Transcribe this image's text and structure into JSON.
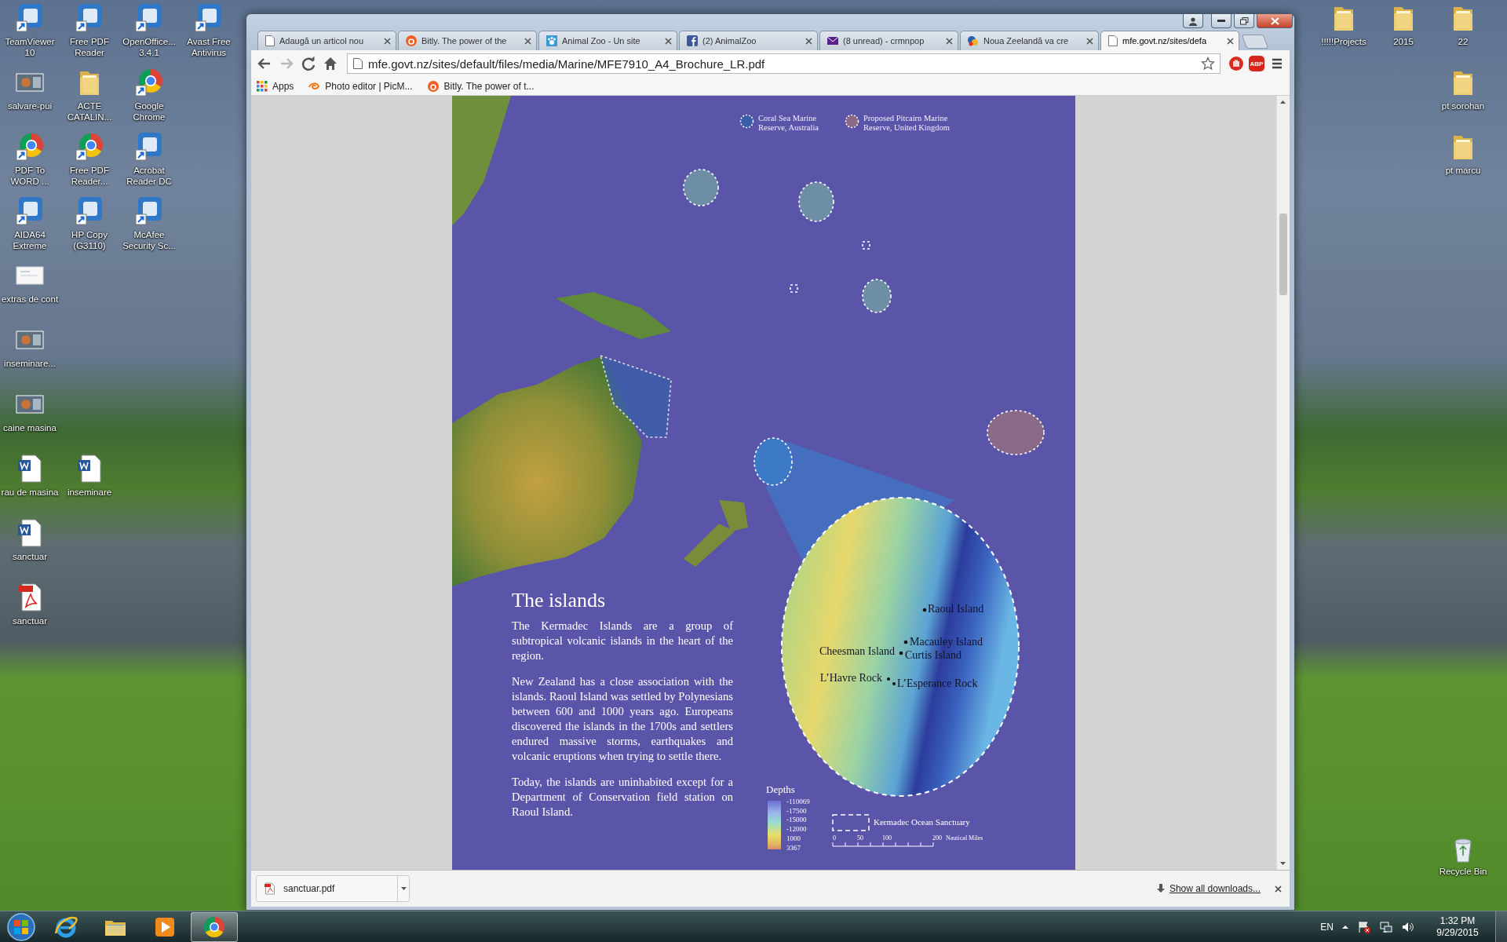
{
  "desktop": {
    "left_icons": [
      [
        {
          "label": "TeamViewer 10",
          "kind": "app",
          "shortcut": true
        },
        {
          "label": "Free PDF Reader",
          "kind": "app",
          "shortcut": true
        },
        {
          "label": "OpenOffice... 3.4.1",
          "kind": "app",
          "shortcut": true
        },
        {
          "label": "Avast Free Antivirus",
          "kind": "app",
          "shortcut": true
        }
      ],
      [
        {
          "label": "salvare-pui",
          "kind": "image",
          "shortcut": false
        },
        {
          "label": "ACTE CATALIN...",
          "kind": "folder",
          "shortcut": false
        },
        {
          "label": "Google Chrome",
          "kind": "chrome",
          "shortcut": true
        }
      ],
      [
        {
          "label": "PDF To WORD ...",
          "kind": "chrome",
          "shortcut": true
        },
        {
          "label": "Free PDF Reader...",
          "kind": "chrome",
          "shortcut": true
        },
        {
          "label": "Acrobat Reader DC",
          "kind": "app",
          "shortcut": true
        }
      ],
      [
        {
          "label": "AIDA64 Extreme",
          "kind": "app",
          "shortcut": true
        },
        {
          "label": "HP Copy (G3110)",
          "kind": "app",
          "shortcut": true
        },
        {
          "label": "McAfee Security Sc...",
          "kind": "app",
          "shortcut": true
        }
      ],
      [
        {
          "label": "extras de cont",
          "kind": "document",
          "shortcut": false
        }
      ],
      [
        {
          "label": "inseminare...",
          "kind": "image",
          "shortcut": false
        }
      ],
      [
        {
          "label": "caine masina",
          "kind": "image",
          "shortcut": false
        }
      ],
      [
        {
          "label": "rau de masina",
          "kind": "word",
          "shortcut": false
        },
        {
          "label": "inseminare",
          "kind": "word",
          "shortcut": false
        }
      ],
      [
        {
          "label": "sanctuar",
          "kind": "word",
          "shortcut": false
        }
      ],
      [
        {
          "label": "sanctuar",
          "kind": "pdf",
          "shortcut": false
        }
      ]
    ],
    "right_icons": [
      [
        {
          "label": "!!!!!Projects",
          "kind": "folder",
          "shortcut": false
        },
        {
          "label": "2015",
          "kind": "folder",
          "shortcut": false
        },
        {
          "label": "22",
          "kind": "folder",
          "shortcut": false
        }
      ],
      [
        {
          "label": "pt sorohan",
          "kind": "folder",
          "shortcut": false
        }
      ],
      [
        {
          "label": "pt marcu",
          "kind": "folder",
          "shortcut": false
        }
      ]
    ],
    "recycle_bin": {
      "label": "Recycle Bin"
    }
  },
  "browser": {
    "tabs": [
      {
        "title": "Adaugă un articol nou",
        "kind": "page",
        "selected": false
      },
      {
        "title": "Bitly. The power of the",
        "kind": "bitly",
        "selected": false
      },
      {
        "title": "Animal Zoo - Un site",
        "kind": "zoo",
        "selected": false
      },
      {
        "title": "(2) AnimalZoo",
        "kind": "facebook",
        "selected": false
      },
      {
        "title": "(8 unread) - crmnpop",
        "kind": "mail",
        "selected": false
      },
      {
        "title": "Noua Zeelandă va cre",
        "kind": "news",
        "selected": false
      },
      {
        "title": "mfe.govt.nz/sites/defa",
        "kind": "page",
        "selected": true
      }
    ],
    "nav_buttons": [
      {
        "kind": "back",
        "disabled": false
      },
      {
        "kind": "forward",
        "disabled": true
      },
      {
        "kind": "reload",
        "disabled": false
      },
      {
        "kind": "home",
        "disabled": false
      }
    ],
    "address": "mfe.govt.nz/sites/default/files/media/Marine/MFE7910_A4_Brochure_LR.pdf",
    "extension_badge": "ABP",
    "bookmarks": [
      {
        "label": "Apps",
        "kind": "apps"
      },
      {
        "label": "Photo editor | PicM...",
        "kind": "photo"
      },
      {
        "label": "Bitly. The power of t...",
        "kind": "bitly"
      }
    ],
    "document": {
      "legend": [
        {
          "label": "Coral Sea Marine Reserve, Australia",
          "color": "#3b5ea8"
        },
        {
          "label": "Proposed Pitcairn Marine Reserve, United Kingdom",
          "color": "#8a6a86"
        }
      ],
      "islands": [
        "Raoul Island",
        "Macauley Island",
        "Cheesman Island",
        "Curtis Island",
        "L’Havre Rock",
        "L’Esperance Rock"
      ],
      "heading": "The islands",
      "paragraphs": [
        "The Kermadec Islands are a group of subtropical volcanic islands in the heart of the region.",
        "New Zealand has a close association with the islands. Raoul Island was settled by Polynesians between 600 and 1000 years ago. Europeans discovered the islands in the 1700s and settlers endured massive storms, earthquakes and volcanic eruptions when trying to settle there.",
        "Today, the islands are uninhabited except for a Department of Conservation field station on Raoul Island."
      ],
      "depths": {
        "title": "Depths",
        "labels": [
          "-110069",
          "-17500",
          "-15000",
          "-12000",
          "1000",
          "3367"
        ]
      },
      "sanctuary_label": "Kermadec Ocean Sanctuary",
      "scale": {
        "ticks": [
          "0",
          "50",
          "100",
          "200"
        ],
        "unit": "Nautical Miles"
      }
    },
    "downloads": {
      "file": "sanctuar.pdf",
      "show_all": "Show all downloads..."
    }
  },
  "taskbar": {
    "apps": [
      {
        "kind": "ie",
        "selected": false
      },
      {
        "kind": "explorer",
        "selected": false
      },
      {
        "kind": "media",
        "selected": false
      },
      {
        "kind": "chrome",
        "selected": true
      }
    ],
    "language": "EN",
    "time": "1:32 PM",
    "date": "9/29/2015"
  }
}
